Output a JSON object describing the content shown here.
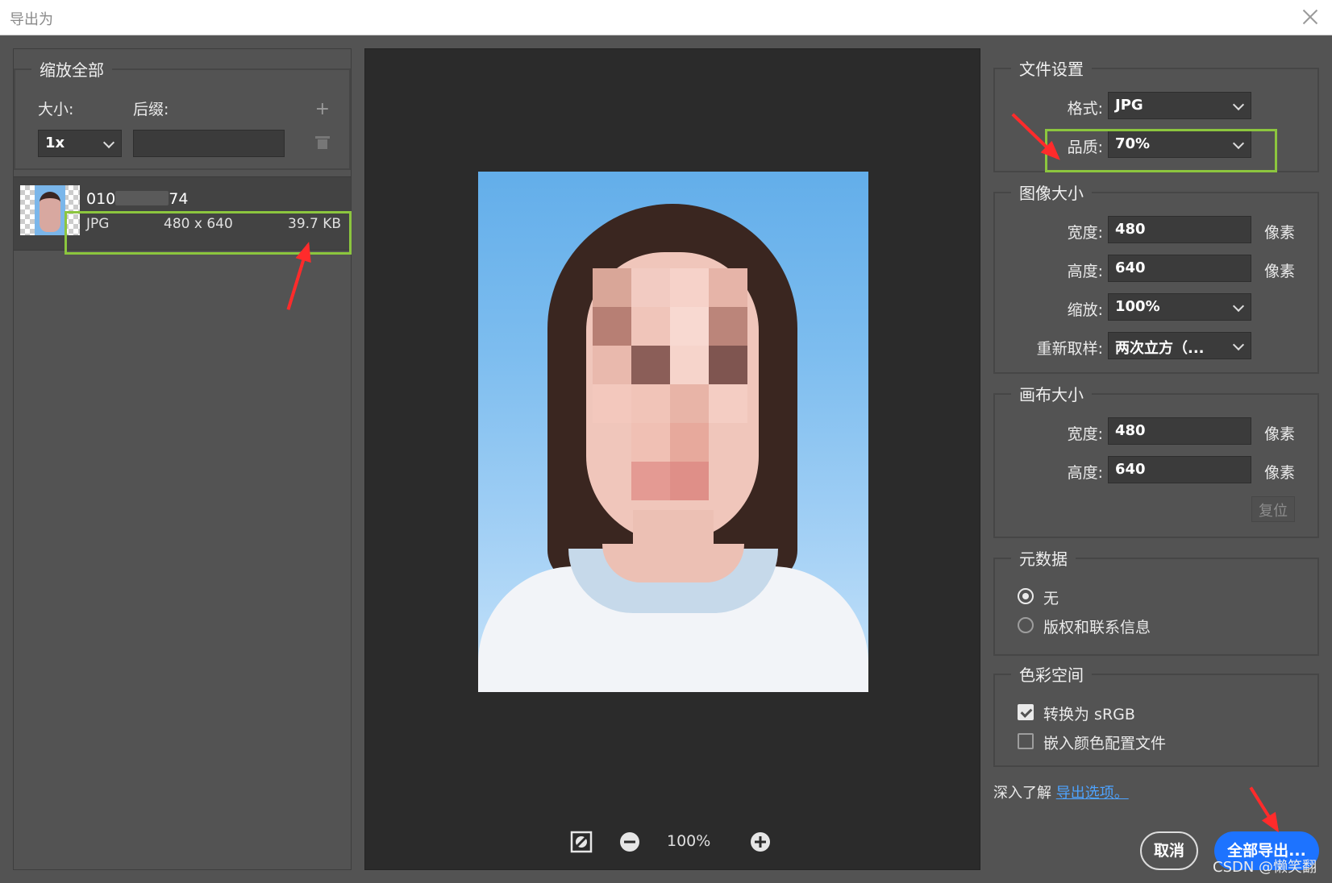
{
  "window": {
    "title": "导出为"
  },
  "left": {
    "scale_group_title": "缩放全部",
    "size_label": "大小:",
    "suffix_label": "后缀:",
    "size_value": "1x",
    "suffix_value": "",
    "asset": {
      "name_prefix": "010",
      "name_suffix": "74",
      "format": "JPG",
      "dimensions": "480 x 640",
      "file_size": "39.7 KB"
    }
  },
  "preview": {
    "zoom": "100%"
  },
  "file_settings": {
    "title": "文件设置",
    "format_label": "格式:",
    "format_value": "JPG",
    "quality_label": "品质:",
    "quality_value": "70%"
  },
  "image_size": {
    "title": "图像大小",
    "width_label": "宽度:",
    "width_value": "480",
    "height_label": "高度:",
    "height_value": "640",
    "unit": "像素",
    "scale_label": "缩放:",
    "scale_value": "100%",
    "resample_label": "重新取样:",
    "resample_value": "两次立方（..."
  },
  "canvas_size": {
    "title": "画布大小",
    "width_label": "宽度:",
    "width_value": "480",
    "height_label": "高度:",
    "height_value": "640",
    "unit": "像素",
    "reset_label": "复位"
  },
  "metadata": {
    "title": "元数据",
    "options": [
      "无",
      "版权和联系信息"
    ],
    "selected": 0
  },
  "color_space": {
    "title": "色彩空间",
    "convert_srgb": "转换为 sRGB",
    "embed_profile": "嵌入颜色配置文件"
  },
  "footer": {
    "learn_text": "深入了解",
    "learn_link": "导出选项。",
    "cancel": "取消",
    "export_all": "全部导出...",
    "watermark": "CSDN @懒笑翻"
  },
  "colors": {
    "highlight": "#8cc63e",
    "arrow": "#ff2b2b",
    "primary": "#1d73ff"
  }
}
